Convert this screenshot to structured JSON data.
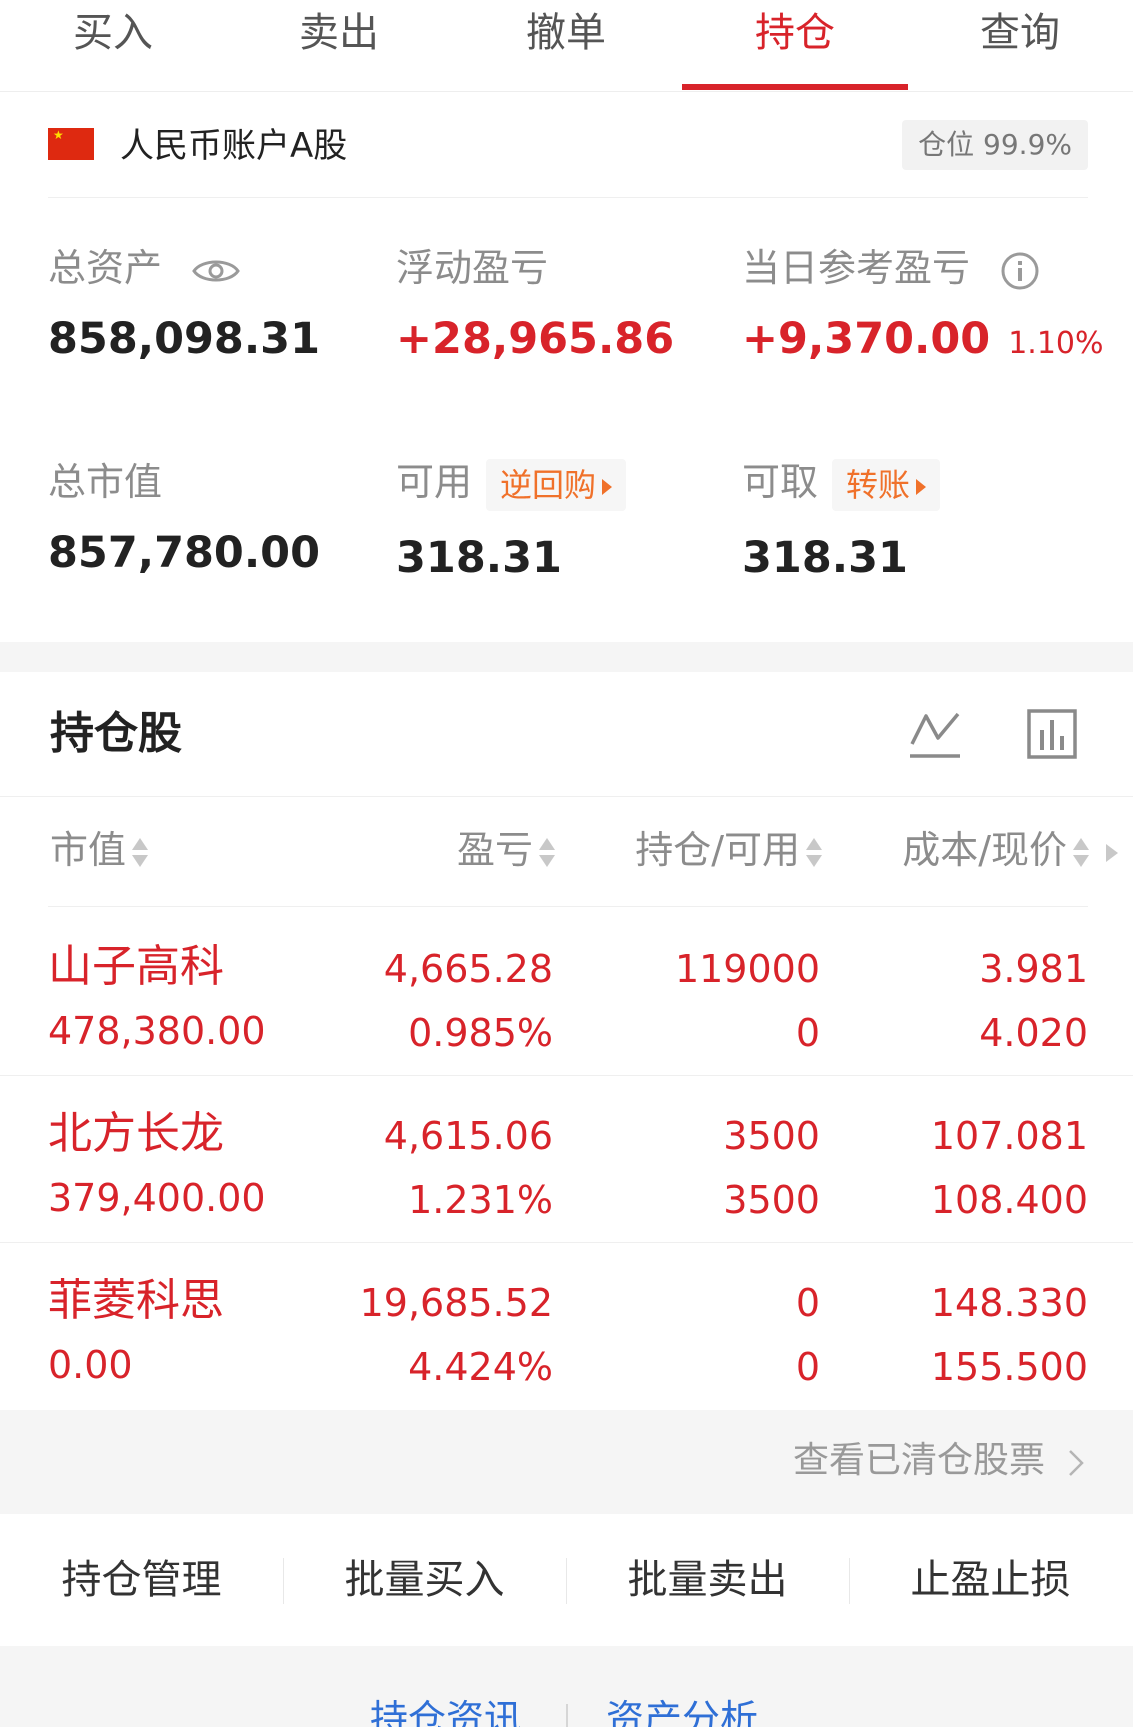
{
  "tabs": [
    {
      "label": "买入",
      "active": false
    },
    {
      "label": "卖出",
      "active": false
    },
    {
      "label": "撤单",
      "active": false
    },
    {
      "label": "持仓",
      "active": true
    },
    {
      "label": "查询",
      "active": false
    }
  ],
  "account": {
    "name": "人民币账户A股",
    "position_label": "仓位 99.9%",
    "flag_icon": "china-flag-icon"
  },
  "summary": {
    "total_assets": {
      "label": "总资产",
      "value": "858,098.31"
    },
    "floating_pnl": {
      "label": "浮动盈亏",
      "value": "+28,965.86"
    },
    "daily_pnl": {
      "label": "当日参考盈亏",
      "value": "+9,370.00",
      "pct": "1.10%"
    },
    "total_market_value": {
      "label": "总市值",
      "value": "857,780.00"
    },
    "available": {
      "label": "可用",
      "value": "318.31",
      "chip": "逆回购"
    },
    "withdrawable": {
      "label": "可取",
      "value": "318.31",
      "chip": "转账"
    }
  },
  "holdings": {
    "title": "持仓股",
    "columns": [
      "市值",
      "盈亏",
      "持仓/可用",
      "成本/现价"
    ],
    "rows": [
      {
        "name": "山子高科",
        "market_value": "478,380.00",
        "pnl": "4,665.28",
        "pnl_pct": "0.985%",
        "position": "119000",
        "available": "0",
        "cost": "3.981",
        "price": "4.020"
      },
      {
        "name": "北方长龙",
        "market_value": "379,400.00",
        "pnl": "4,615.06",
        "pnl_pct": "1.231%",
        "position": "3500",
        "available": "3500",
        "cost": "107.081",
        "price": "108.400"
      },
      {
        "name": "菲菱科思",
        "market_value": "0.00",
        "pnl": "19,685.52",
        "pnl_pct": "4.424%",
        "position": "0",
        "available": "0",
        "cost": "148.330",
        "price": "155.500"
      }
    ],
    "cleared_link": "查看已清仓股票"
  },
  "actions": [
    "持仓管理",
    "批量买入",
    "批量卖出",
    "止盈止损"
  ],
  "bottom_links": [
    "持仓资讯",
    "资产分析"
  ],
  "colors": {
    "accent_red": "#d8232a",
    "chip_orange": "#f0712a",
    "link_blue": "#2f6fd6"
  }
}
